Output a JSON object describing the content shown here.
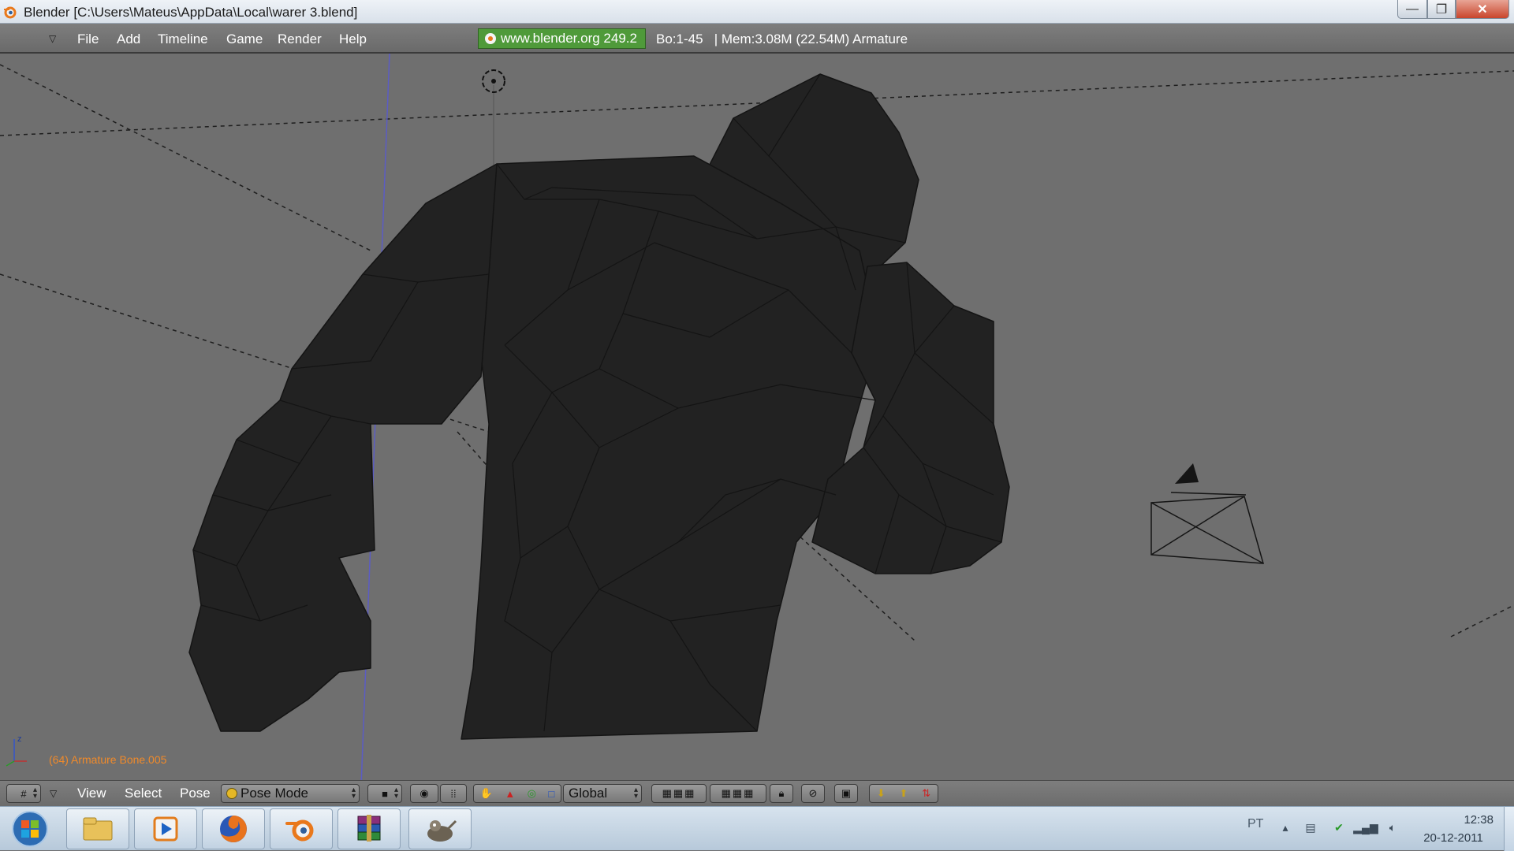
{
  "window": {
    "title": "Blender [C:\\Users\\Mateus\\AppData\\Local\\warer 3.blend]",
    "minimize": "—",
    "maximize": "❐",
    "close": "✕"
  },
  "infobar": {
    "menus": [
      "File",
      "Add",
      "Timeline",
      "Game",
      "Render",
      "Help"
    ],
    "site_badge": "www.blender.org 249.2",
    "stats": "Bo:1-45   | Mem:3.08M (22.54M) Armature"
  },
  "viewport": {
    "status_label": "(64) Armature Bone.005",
    "axis_label": "z"
  },
  "viewport_header": {
    "menus": [
      "View",
      "Select",
      "Pose"
    ],
    "mode": "Pose Mode",
    "orientation": "Global"
  },
  "taskbar": {
    "apps": [
      "windows-explorer",
      "media-player",
      "firefox",
      "blender",
      "winrar",
      "gimp"
    ],
    "language": "PT",
    "time": "12:38",
    "date": "20-12-2011"
  },
  "colors": {
    "status_label": "#f08a2a",
    "site_badge": "#4f9a3a",
    "viewport_bg": "#6f6f6f",
    "mesh": "#232323"
  }
}
